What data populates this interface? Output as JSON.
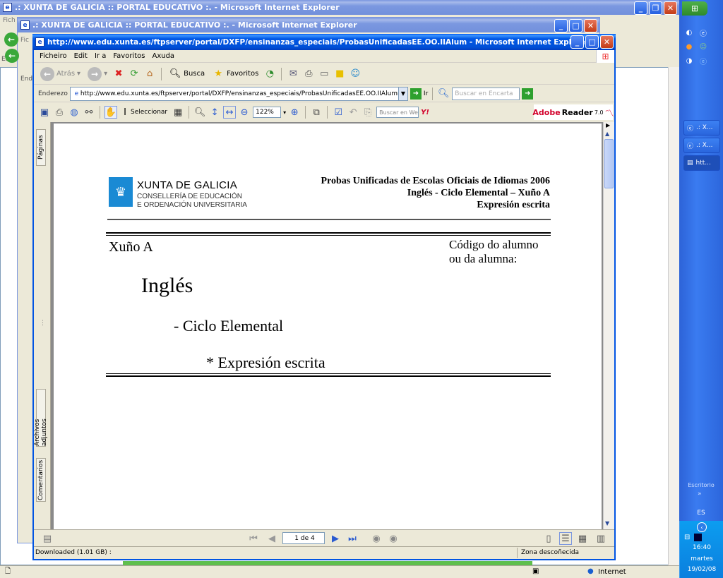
{
  "windows": {
    "back": {
      "title": ".: XUNTA DE GALICIA :: PORTAL EDUCATIVO :. - Microsoft Internet Explorer"
    },
    "middle": {
      "title": ".: XUNTA DE GALICIA :: PORTAL EDUCATIVO :. - Microsoft Internet Explorer"
    },
    "front": {
      "title": "http://www.edu.xunta.es/ftpserver/portal/DXFP/ensinanzas_especiais/ProbasUnificadasEE.OO.IIAlum - Microsoft Internet Explorer"
    }
  },
  "back_partial": {
    "menu_fragment": "Fich",
    "addr_fragment": "Ende",
    "addr_fragment2": "Ende",
    "menu_fragment2": "Fic"
  },
  "menubar": [
    "Ficheiro",
    "Edit",
    "Ir a",
    "Favoritos",
    "Axuda"
  ],
  "toolbar": {
    "back": "Atrás",
    "search": "Busca",
    "favorites": "Favoritos"
  },
  "address": {
    "label": "Enderezo",
    "url": "http://www.edu.xunta.es/ftpserver/portal/DXFP/ensinanzas_especiais/ProbasUnificadasEE.OO.IIAlumnadolibre.",
    "go": "Ir",
    "search_placeholder": "Buscar en Encarta"
  },
  "reader_toolbar": {
    "select": "Seleccionar",
    "zoom": "122%",
    "web_search": "Buscar en Web",
    "yahoo": "Y!",
    "brand": "Adobe",
    "brand_product": "Reader",
    "version": "7.0"
  },
  "side_tabs": {
    "pages": "Páginas",
    "attachments": "Archivos adjuntos",
    "comments": "Comentarios"
  },
  "document": {
    "org_name": "XUNTA DE GALICIA",
    "org_dept1": "CONSELLERÍA DE EDUCACIÓN",
    "org_dept2": "E ORDENACIÓN UNIVERSITARIA",
    "header1": "Probas Unificadas de Escolas Oficiais de Idiomas 2006",
    "header2": "Inglés - Ciclo Elemental – Xuño A",
    "header3": "Expresión escrita",
    "session": "Xuño A",
    "code_label1": "Código do alumno",
    "code_label2": "ou da alumna:",
    "language": "Inglés",
    "cycle": "- Ciclo Elemental",
    "skill": "* Expresión escrita"
  },
  "pagination": {
    "page": "1 de 4"
  },
  "statusbar": {
    "left": "Downloaded (1.01 GB) :",
    "zone": "Zona descoñecida",
    "zone_back": "Internet"
  },
  "taskbar": {
    "items": [
      ".: X...",
      ".: X...",
      "htt..."
    ],
    "desktop": "Escritorio",
    "lang": "ES",
    "time": "16:40",
    "day": "martes",
    "date": "19/02/08"
  }
}
